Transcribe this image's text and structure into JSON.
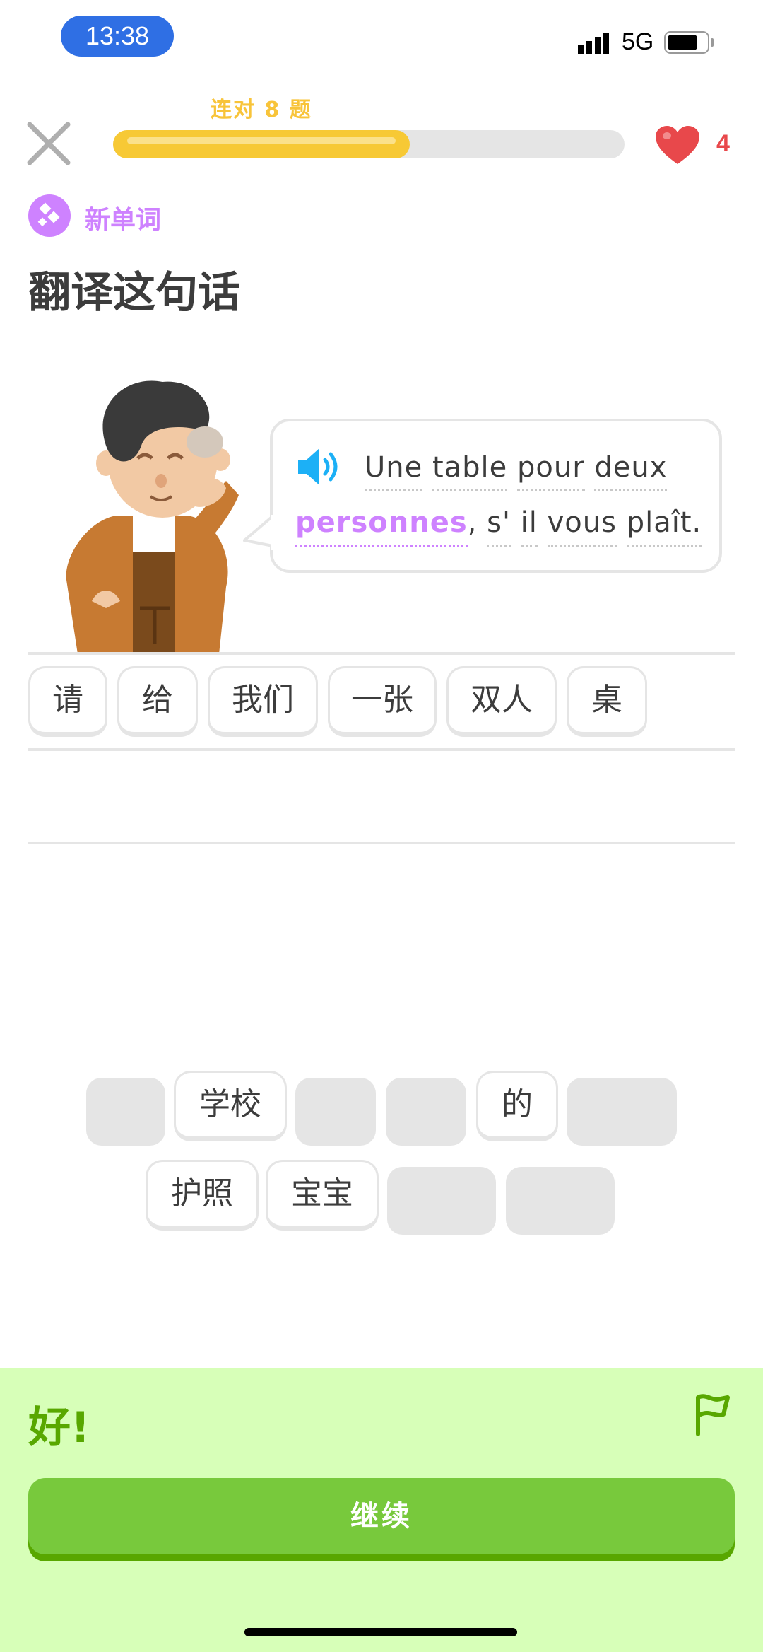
{
  "status_bar": {
    "time": "13:38",
    "network": "5G"
  },
  "header": {
    "streak_label": "连对 8 题",
    "progress_fraction": 0.58,
    "hearts": "4"
  },
  "exercise": {
    "badge": "新单词",
    "title": "翻译这句话",
    "sentence_tokens": [
      "Une",
      "table",
      "pour",
      "deux",
      "personnes",
      ",",
      "s'",
      "il",
      "vous",
      "plaît."
    ],
    "new_word": "personnes"
  },
  "answer_chips": [
    "请",
    "给",
    "我们",
    "一张",
    "双人",
    "桌"
  ],
  "word_bank": {
    "row1": [
      {
        "label": ""
      },
      {
        "label": "学校"
      },
      {
        "label": ""
      },
      {
        "label": ""
      },
      {
        "label": "的"
      },
      {
        "label": ""
      }
    ],
    "row2": [
      {
        "label": "护照"
      },
      {
        "label": "宝宝"
      },
      {
        "label": ""
      },
      {
        "label": ""
      }
    ]
  },
  "footer": {
    "feedback": "好!",
    "continue_label": "继续"
  },
  "colors": {
    "accent_green": "#78c93c",
    "new_word_purple": "#ce82ff",
    "progress_yellow": "#f7c935",
    "heart_red": "#e8484b"
  },
  "icons": [
    "close-icon",
    "heart-icon",
    "speaker-icon",
    "flag-icon",
    "signal-icon",
    "battery-icon"
  ]
}
